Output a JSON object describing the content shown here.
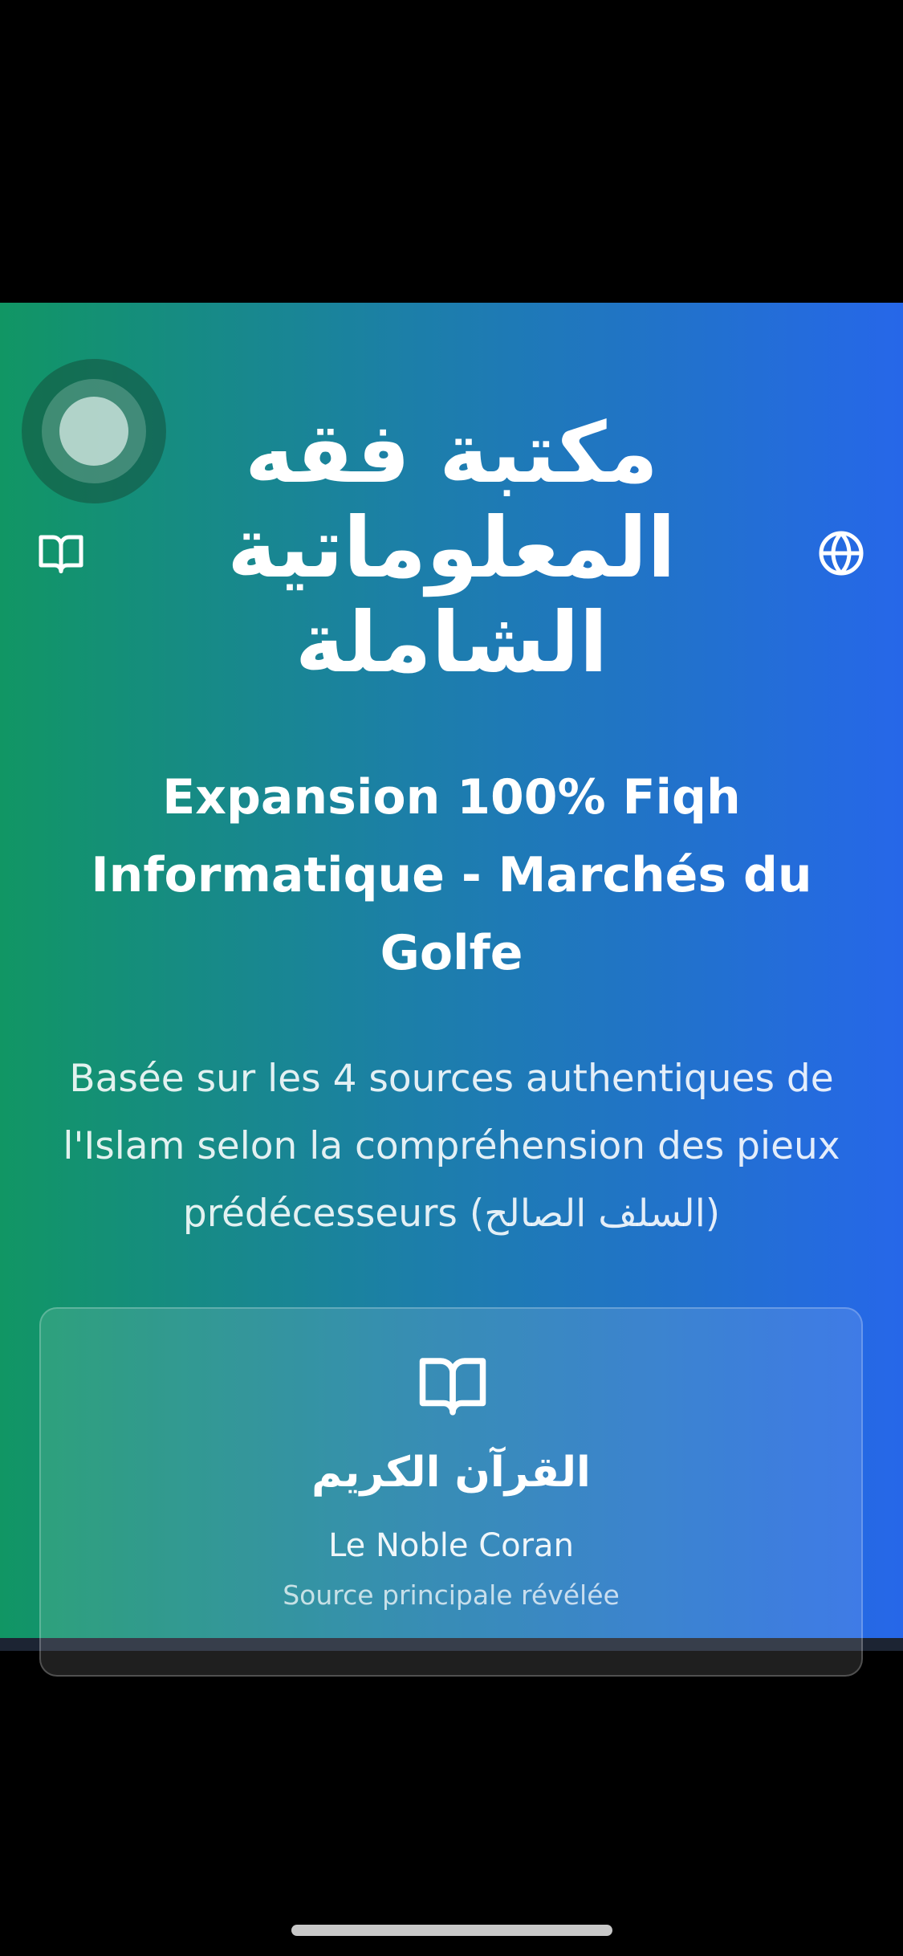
{
  "hero": {
    "arabic_title_lines": [
      "مكتبة فقه",
      "المعلوماتية",
      "الشاملة"
    ],
    "subtitle_lines": [
      "Expansion 100% Fiqh",
      "Informatique - Marchés du",
      "Golfe"
    ],
    "description_lines": [
      "Basée sur les 4 sources authentiques de",
      "l'Islam selon la compréhension des pieux",
      "prédécesseurs (السلف الصالح)"
    ],
    "left_icon": "book-icon",
    "right_icon": "globe-icon"
  },
  "source_card": {
    "icon": "book-open-icon",
    "arabic_name": "القرآن الكريم",
    "title": "Le Noble Coran",
    "caption": "Source principale révélée"
  },
  "colors": {
    "gradient_start": "#119664",
    "gradient_end": "#2667e9",
    "text": "#ffffff"
  }
}
